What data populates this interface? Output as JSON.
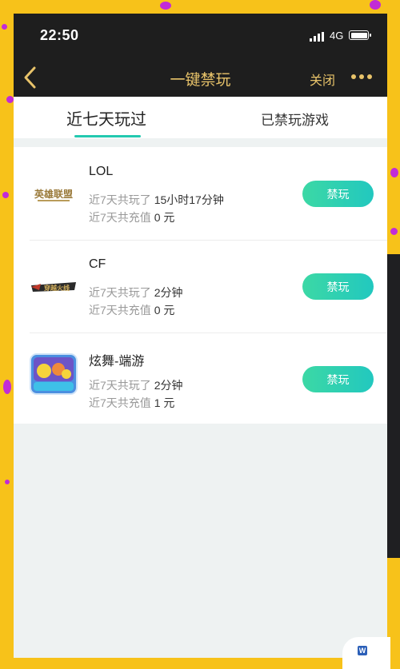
{
  "status": {
    "time": "22:50",
    "network": "4G"
  },
  "nav": {
    "title": "一键禁玩",
    "close_label": "关闭"
  },
  "tabs": [
    {
      "label": "近七天玩过",
      "active": true
    },
    {
      "label": "已禁玩游戏",
      "active": false
    }
  ],
  "games": [
    {
      "name": "LOL",
      "played_label": "近7天共玩了",
      "played_value": "15小时17分钟",
      "recharge_label": "近7天共充值",
      "recharge_value": "0 元",
      "button": "禁玩",
      "logo": "lol-logo",
      "logo_text": "英雄联盟"
    },
    {
      "name": "CF",
      "played_label": "近7天共玩了",
      "played_value": "2分钟",
      "recharge_label": "近7天共充值",
      "recharge_value": "0 元",
      "button": "禁玩",
      "logo": "cf-logo",
      "logo_text": "穿越火线"
    },
    {
      "name": "炫舞-端游",
      "played_label": "近7天共玩了",
      "played_value": "2分钟",
      "recharge_label": "近7天共充值",
      "recharge_value": "1 元",
      "button": "禁玩",
      "logo": "x5-logo"
    }
  ],
  "colors": {
    "accent": "#23c9b0",
    "nav_bg": "#1e1e1e",
    "nav_text": "#e8c36a",
    "button_from": "#3cd8a5",
    "button_to": "#22c8bf"
  }
}
